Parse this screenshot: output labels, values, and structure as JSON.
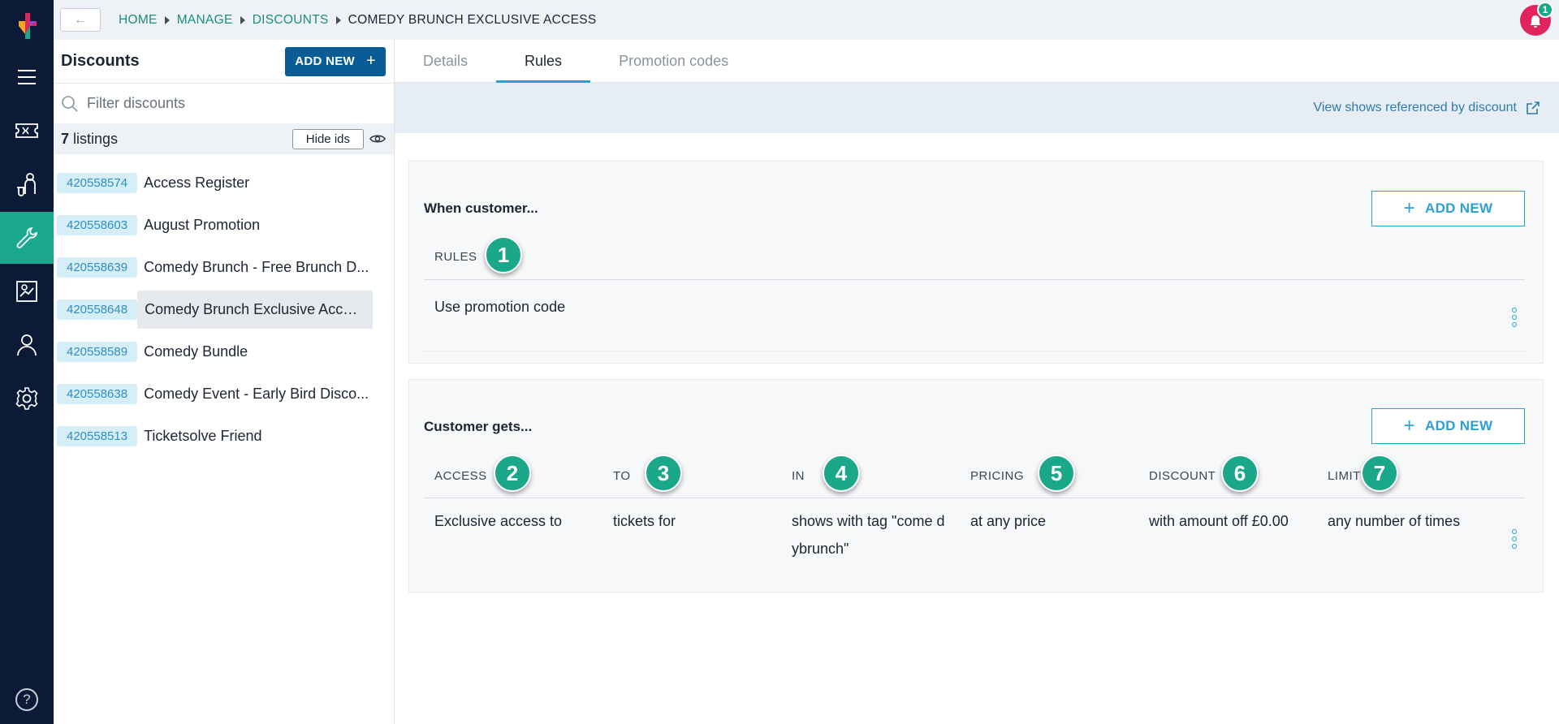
{
  "topbar": {
    "breadcrumbs": [
      "HOME",
      "MANAGE",
      "DISCOUNTS"
    ],
    "current": "COMEDY BRUNCH EXCLUSIVE ACCESS",
    "notifications": "1"
  },
  "rail": {
    "icons": [
      "menu-icon",
      "ticket-icon",
      "customer-service-icon",
      "wrench-icon",
      "report-icon",
      "user-icon",
      "settings-icon",
      "help-icon"
    ],
    "active": "wrench-icon",
    "help_label": "?"
  },
  "sidebar": {
    "title": "Discounts",
    "add_new": "ADD NEW",
    "filter_placeholder": "Filter discounts",
    "count": "7",
    "count_label": "listings",
    "hide_ids": "Hide ids",
    "items": [
      {
        "id": "420558574",
        "name": "Access Register"
      },
      {
        "id": "420558603",
        "name": "August Promotion"
      },
      {
        "id": "420558639",
        "name": "Comedy Brunch - Free Brunch D..."
      },
      {
        "id": "420558648",
        "name": "Comedy Brunch Exclusive Access"
      },
      {
        "id": "420558589",
        "name": "Comedy Bundle"
      },
      {
        "id": "420558638",
        "name": "Comedy Event - Early Bird Disco..."
      },
      {
        "id": "420558513",
        "name": "Ticketsolve Friend"
      }
    ]
  },
  "tabs": [
    "Details",
    "Rules",
    "Promotion codes"
  ],
  "active_tab": "Rules",
  "info_bar": {
    "link": "View shows referenced by discount"
  },
  "when_card": {
    "title": "When customer...",
    "add_new": "ADD NEW",
    "header": "RULES",
    "badge": "1",
    "row": "Use promotion code"
  },
  "gets_card": {
    "title": "Customer gets...",
    "add_new": "ADD NEW",
    "columns": [
      {
        "head": "ACCESS",
        "badge": "2",
        "value": "Exclusive access to"
      },
      {
        "head": "TO",
        "badge": "3",
        "value": "tickets for"
      },
      {
        "head": "IN",
        "badge": "4",
        "value": "shows with tag \"come dybrunch\""
      },
      {
        "head": "PRICING",
        "badge": "5",
        "value": "at any price"
      },
      {
        "head": "DISCOUNT",
        "badge": "6",
        "value": "with amount off £0.00"
      },
      {
        "head": "LIMIT",
        "badge": "7",
        "value": "any number of times"
      }
    ]
  },
  "colors": {
    "rail": "#0b1a36",
    "active": "#1aa88f",
    "primary": "#0a5c97",
    "accent": "#2aa0d4",
    "badge": "#1aa78a"
  }
}
